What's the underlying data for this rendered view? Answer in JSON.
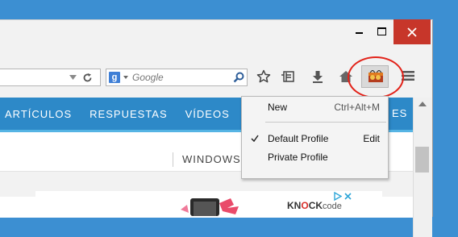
{
  "window": {
    "minimize_label": "minimize",
    "maximize_label": "maximize",
    "close_label": "close"
  },
  "toolbar": {
    "search_placeholder": "Google",
    "search_engine_letter": "g"
  },
  "site_nav": {
    "items": [
      "ARTÍCULOS",
      "RESPUESTAS",
      "VÍDEOS"
    ],
    "trailing_item": "ES"
  },
  "page": {
    "secondary_link": "WINDOWS"
  },
  "ad": {
    "brand_knock": "KN",
    "brand_o": "O",
    "brand_ck": "CK",
    "brand_code": "code"
  },
  "profile_menu": {
    "new_label": "New",
    "new_shortcut": "Ctrl+Alt+M",
    "default_profile_label": "Default Profile",
    "default_profile_action": "Edit",
    "private_profile_label": "Private Profile"
  },
  "colors": {
    "desktop": "#3c8fd2",
    "close_button": "#c7362a",
    "site_nav": "#2d89c8",
    "highlight": "#e2231a"
  }
}
